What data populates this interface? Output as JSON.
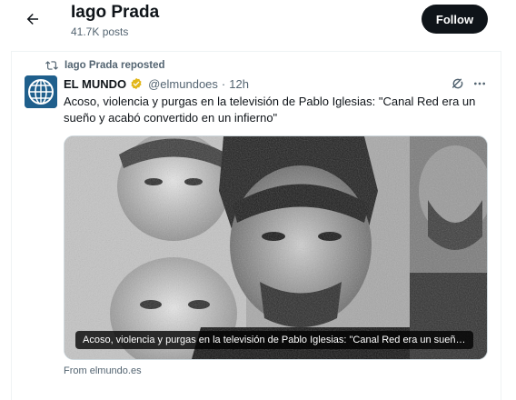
{
  "header": {
    "name": "Iago Prada",
    "post_count": "41.7K posts",
    "follow_label": "Follow"
  },
  "repost": {
    "label": "Iago Prada reposted"
  },
  "tweet": {
    "author": "EL MUNDO",
    "handle": "@elmundoes",
    "separator": "·",
    "time": "12h",
    "text": "Acoso, violencia y purgas en la televisión de Pablo Iglesias: \"Canal Red era un sueño y acabó convertido en un infierno\"",
    "media_caption": "Acoso, violencia y purgas en la televisión de Pablo Iglesias: \"Canal Red era un sueño y acabó convertido en un infierno\"",
    "source": "From elmundo.es"
  },
  "icons": {
    "back": "arrow-left-icon",
    "repost": "repost-icon",
    "verified": "verified-badge-icon",
    "grok": "grok-icon",
    "more": "more-icon"
  },
  "colors": {
    "follow_bg": "#0f1419",
    "secondary_text": "#536471",
    "verified_gold": "#e2b719",
    "avatar_blue": "#1f5f8c"
  }
}
